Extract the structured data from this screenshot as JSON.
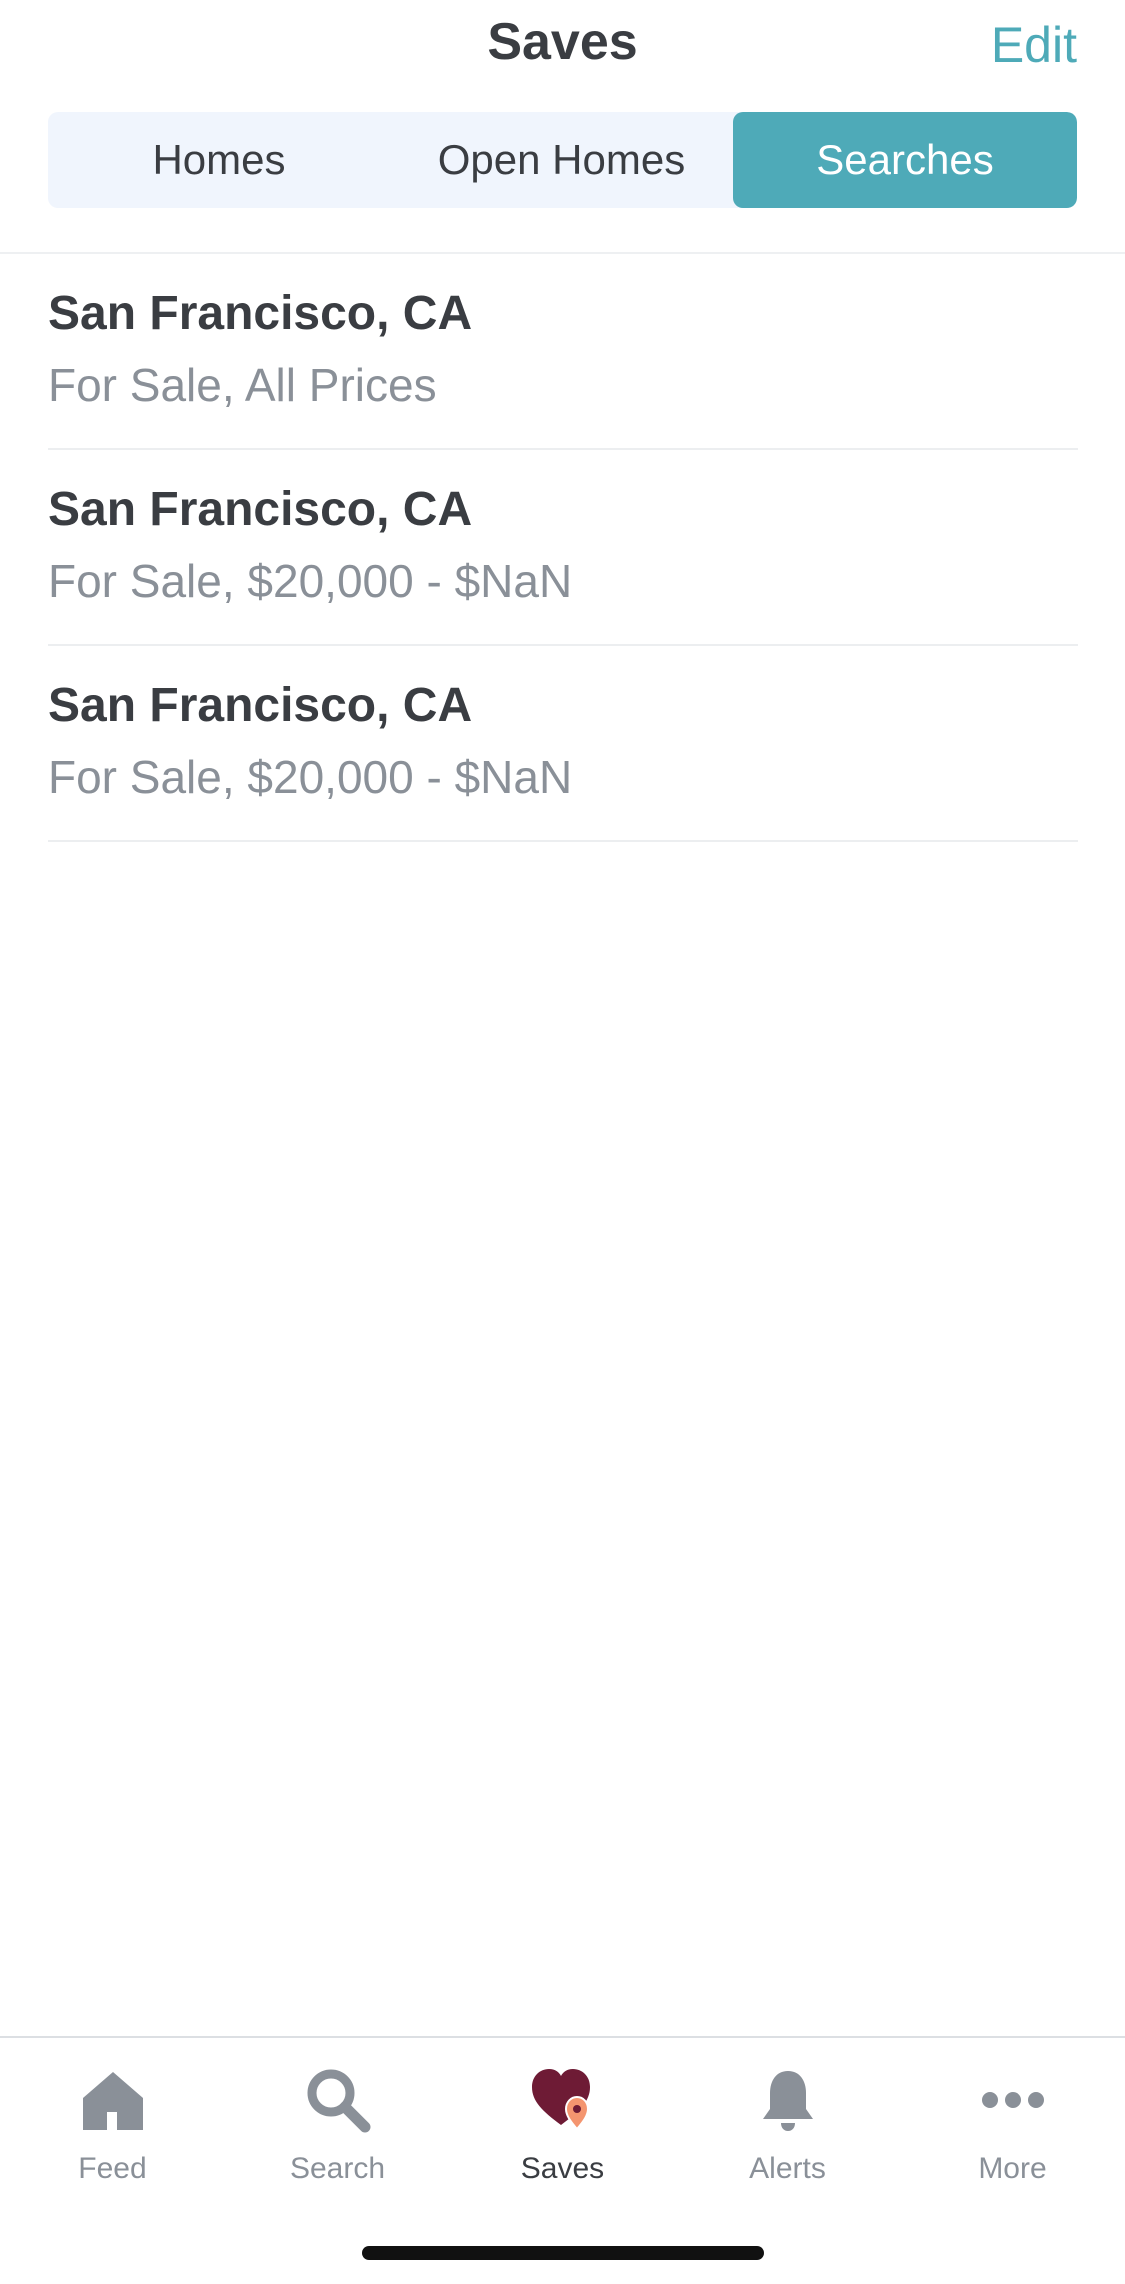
{
  "header": {
    "title": "Saves",
    "edit_label": "Edit"
  },
  "segments": [
    {
      "label": "Homes",
      "selected": false
    },
    {
      "label": "Open Homes",
      "selected": false
    },
    {
      "label": "Searches",
      "selected": true
    }
  ],
  "saved_searches": [
    {
      "title": "San Francisco, CA",
      "subtitle": "For Sale, All Prices"
    },
    {
      "title": "San Francisco, CA",
      "subtitle": "For Sale, $20,000 - $NaN"
    },
    {
      "title": "San Francisco, CA",
      "subtitle": "For Sale, $20,000 - $NaN"
    }
  ],
  "tabbar": {
    "items": [
      {
        "label": "Feed",
        "icon": "house-icon",
        "active": false
      },
      {
        "label": "Search",
        "icon": "magnifier-icon",
        "active": false
      },
      {
        "label": "Saves",
        "icon": "heart-pin-icon",
        "active": true
      },
      {
        "label": "Alerts",
        "icon": "bell-icon",
        "active": false
      },
      {
        "label": "More",
        "icon": "ellipsis-icon",
        "active": false
      }
    ]
  },
  "colors": {
    "accent": "#4eaab8",
    "segment_bg": "#f0f5fd",
    "heart": "#6e1b35",
    "pin": "#f4956f",
    "inactive_icon": "#8a9098"
  }
}
